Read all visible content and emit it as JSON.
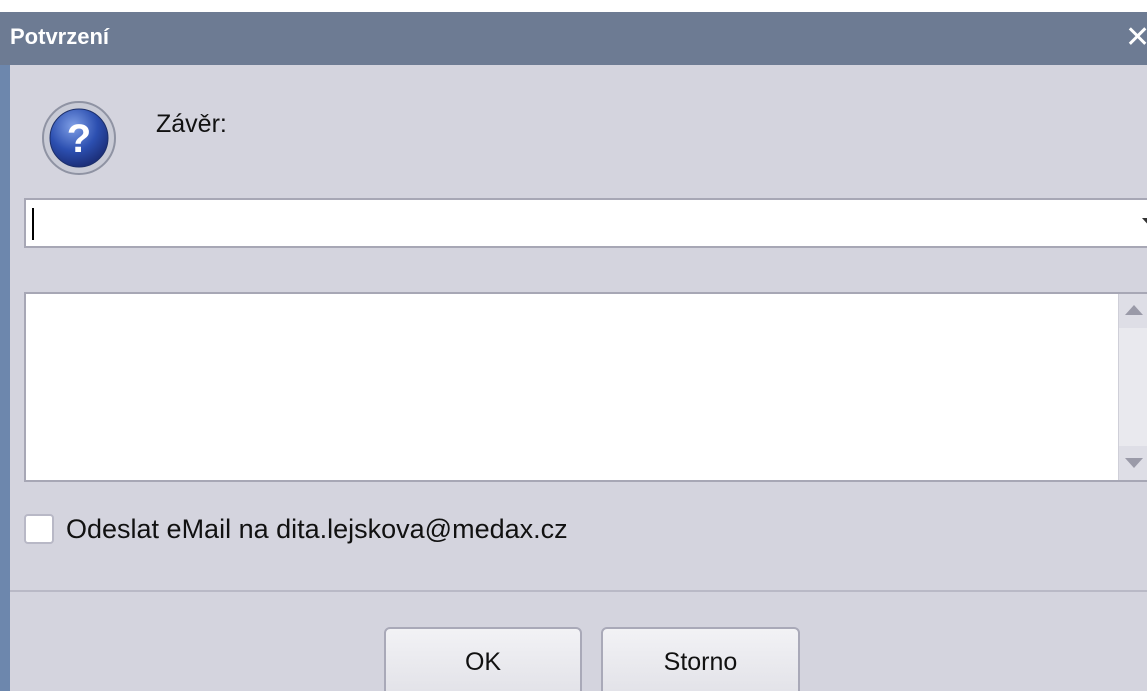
{
  "window": {
    "title": "Potvrzení"
  },
  "prompt": {
    "label": "Závěr:",
    "icon": "question-icon"
  },
  "conclusion_combo": {
    "value": ""
  },
  "note_memo": {
    "value": ""
  },
  "email_option": {
    "label": "Odeslat eMail na dita.lejskova@medax.cz",
    "checked": false
  },
  "buttons": {
    "ok_label": "OK",
    "cancel_label": "Storno"
  },
  "colors": {
    "titlebar": "#6d7b93",
    "dialog_background": "#d4d4de",
    "window_frame": "#6d87ad"
  }
}
